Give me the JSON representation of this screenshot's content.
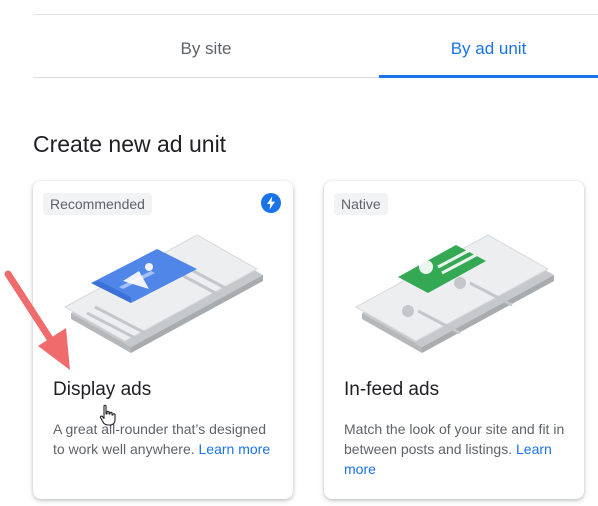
{
  "tabs": [
    {
      "label": "By site"
    },
    {
      "label": "By ad unit"
    }
  ],
  "section_title": "Create new ad unit",
  "cards": [
    {
      "badge": "Recommended",
      "title": "Display ads",
      "description": "A great all-rounder that’s designed to work well anywhere.",
      "link": "Learn more"
    },
    {
      "badge": "Native",
      "title": "In-feed ads",
      "description": "Match the look of your site and fit in between posts and listings.",
      "link": "Learn more"
    }
  ],
  "colors": {
    "accent": "#1a73e8",
    "native_green": "#34a853",
    "display_blue": "#4285f4",
    "annotation_arrow": "#f06b6b"
  },
  "icons": {
    "recommended": "bolt-icon",
    "pointer": "hand-cursor-icon",
    "annotation": "red-arrow-icon"
  }
}
